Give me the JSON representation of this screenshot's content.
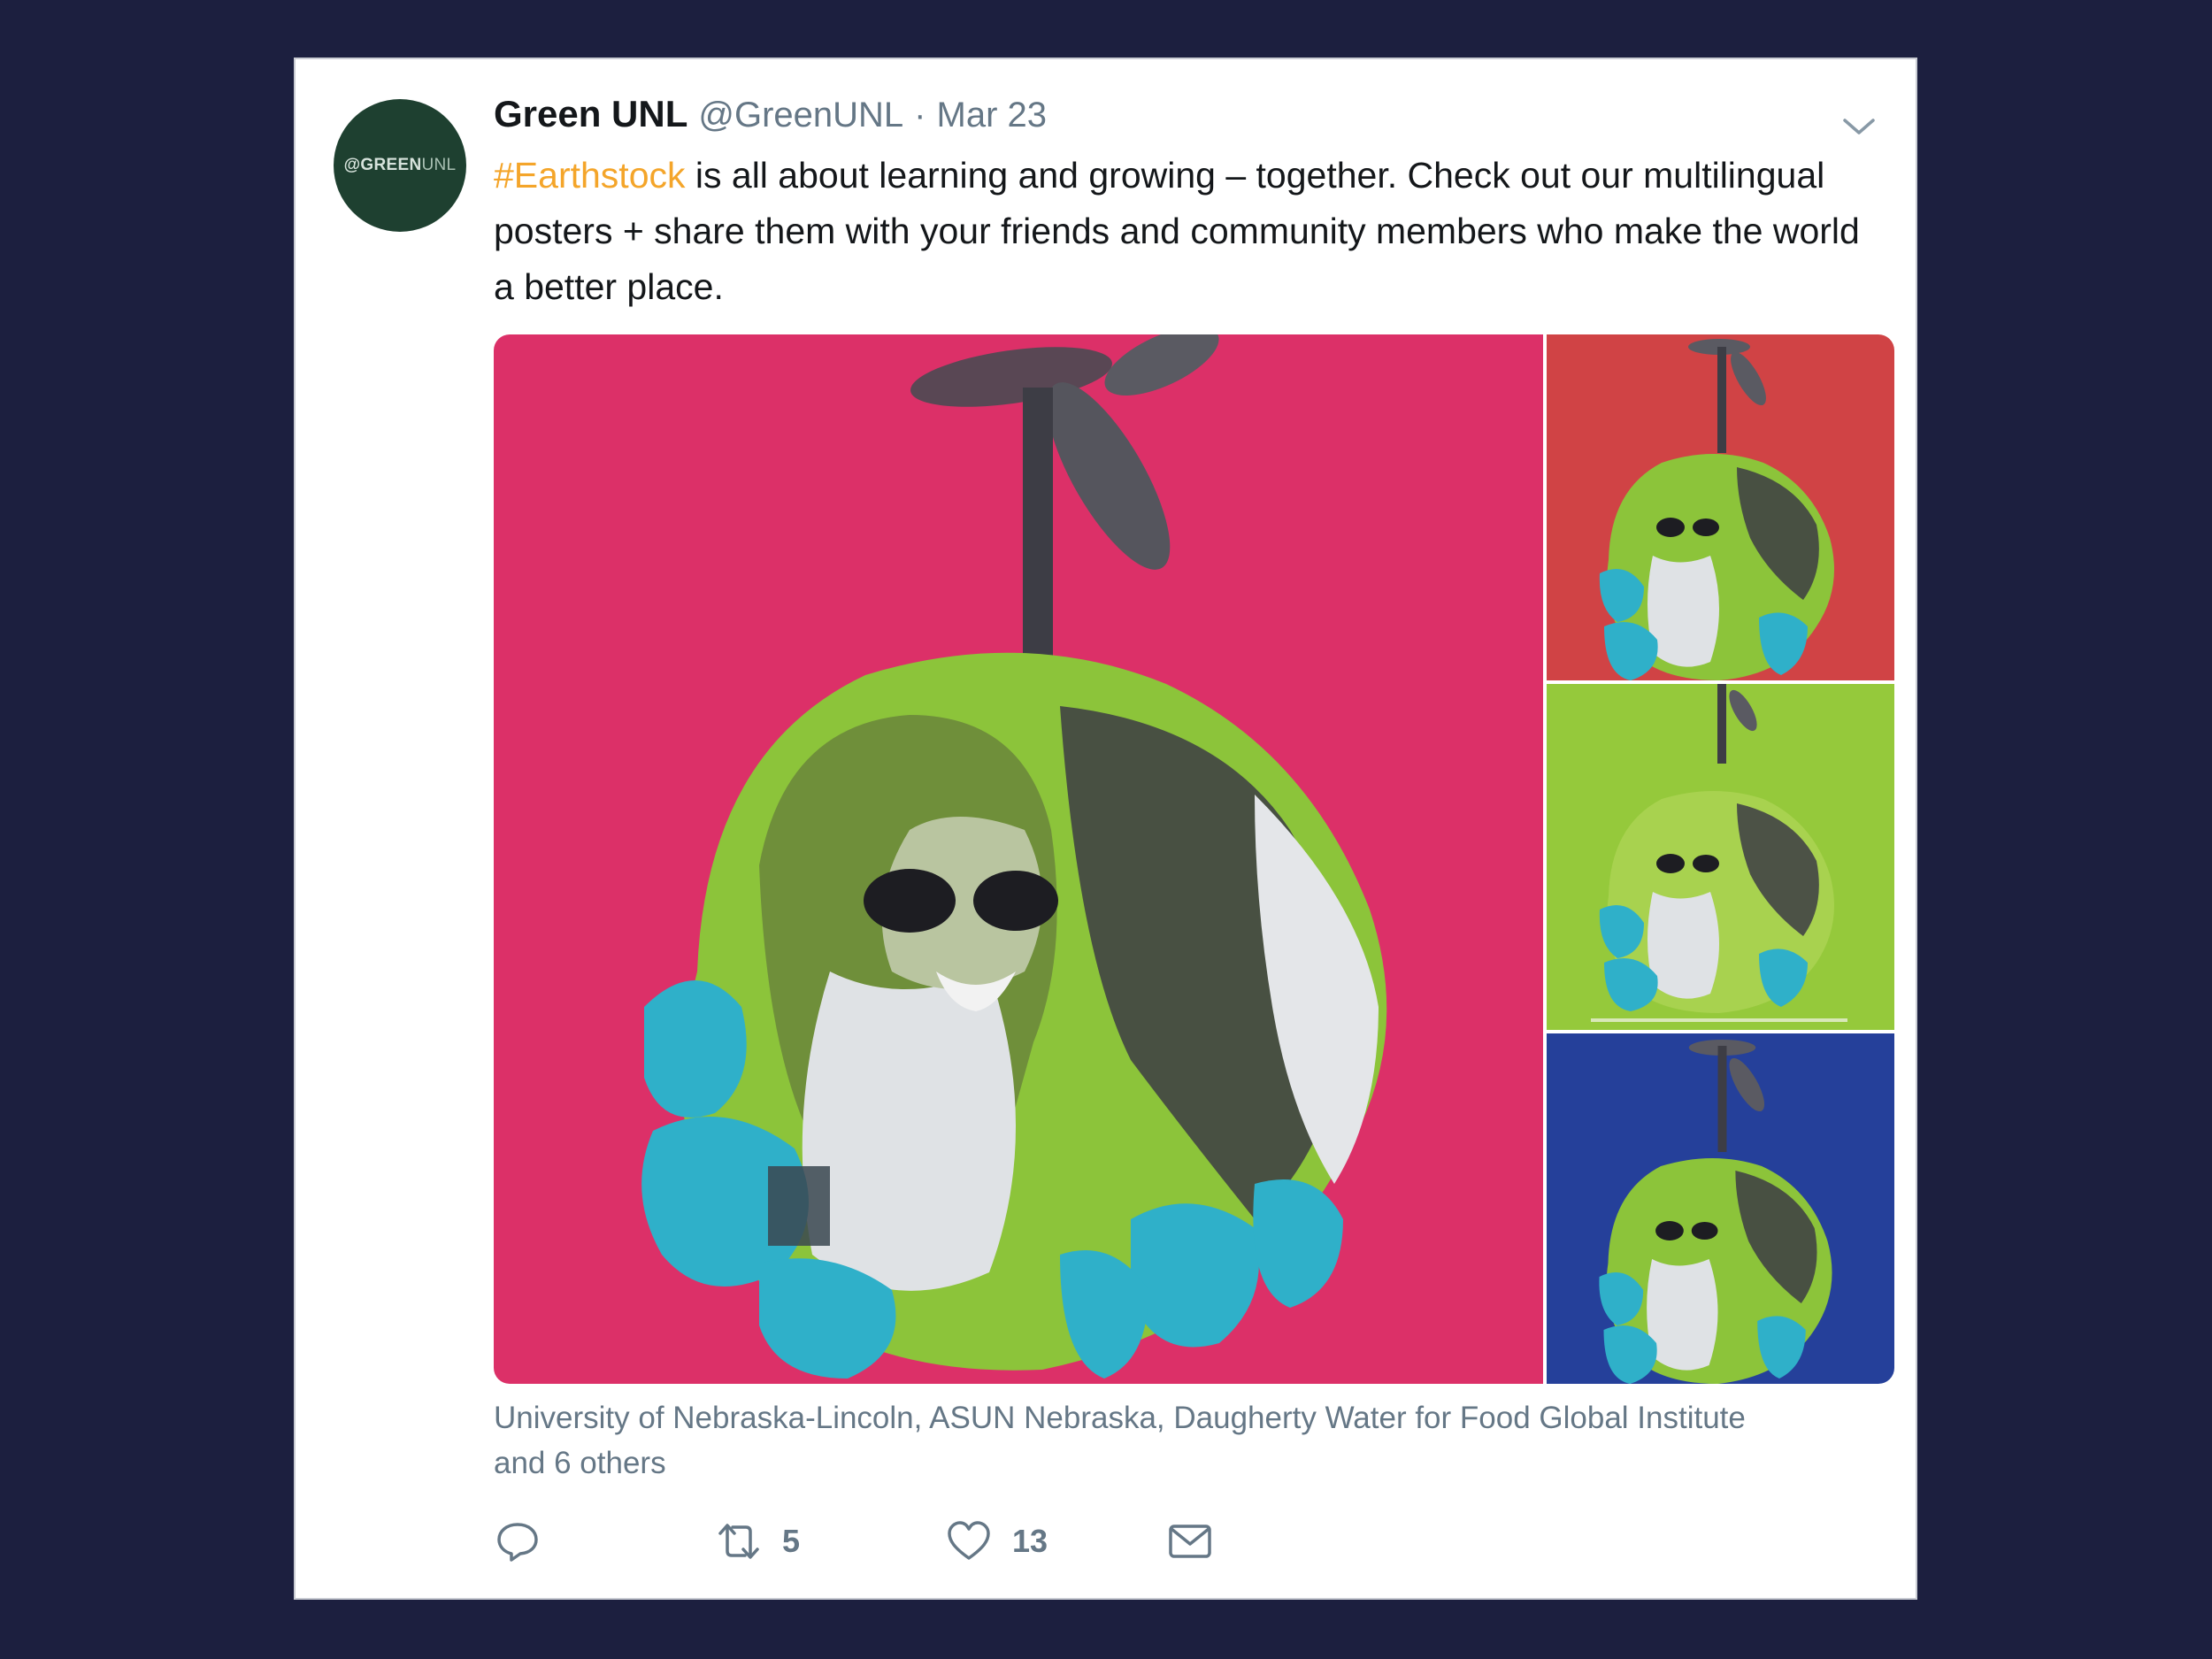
{
  "tweet": {
    "avatar_text_bold": "@GREEN",
    "avatar_text_thin": "UNL",
    "display_name": "Green UNL",
    "handle": "@GreenUNL",
    "separator": "·",
    "date": "Mar 23",
    "hashtag": "#Earthstock",
    "text": " is all about learning and growing – together. Check out our multilingual posters + share them with your friends and community members who make the world a better place.",
    "tagged_line1": "University of Nebraska-Lincoln, ASUN Nebraska, Daugherty Water for Food Global Institute",
    "tagged_line2": "and 6 others"
  },
  "actions": {
    "retweet_count": "5",
    "like_count": "13"
  },
  "media": {
    "tiles": [
      {
        "name": "pink-poster",
        "color": "#dc3068"
      },
      {
        "name": "red-poster",
        "color": "#d04345"
      },
      {
        "name": "green-poster",
        "color": "#95c93b"
      },
      {
        "name": "blue-poster",
        "color": "#25409a"
      }
    ]
  },
  "colors": {
    "background": "#1c1f3f",
    "hashtag": "#f4a52a",
    "secondary_text": "#657786",
    "avatar": "#1e4030"
  },
  "icons": [
    "chevron-down-icon",
    "reply-icon",
    "retweet-icon",
    "like-icon",
    "message-icon"
  ]
}
